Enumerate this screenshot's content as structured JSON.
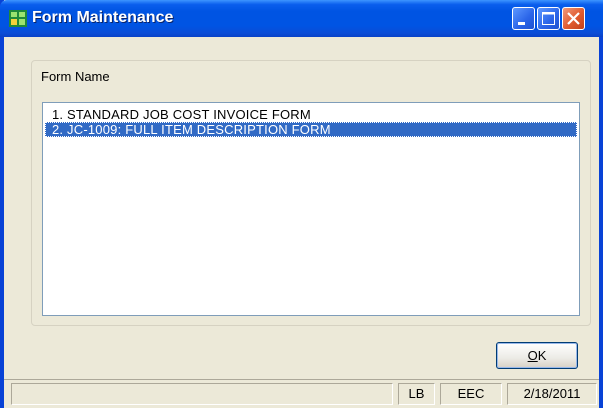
{
  "window": {
    "title": "Form Maintenance",
    "app_icon": "grid-spreadsheet-icon",
    "controls": [
      "minimize-icon",
      "maximize-icon",
      "close-icon"
    ]
  },
  "form_group": {
    "label": "Form Name",
    "items": [
      {
        "text": "1.  STANDARD JOB COST INVOICE FORM",
        "selected": false
      },
      {
        "text": "2.  JC-1009:  FULL ITEM DESCRIPTION FORM",
        "selected": true
      }
    ]
  },
  "buttons": {
    "ok_mnemonic": "O",
    "ok_rest": "K"
  },
  "status_bar": {
    "message": "",
    "user": "LB",
    "company": "EEC",
    "date": "2/18/2011"
  },
  "colors": {
    "titlebar": "#0054e3",
    "selection": "#316ac5",
    "dialog_bg": "#ece9d8",
    "close_button": "#e05a2e"
  }
}
